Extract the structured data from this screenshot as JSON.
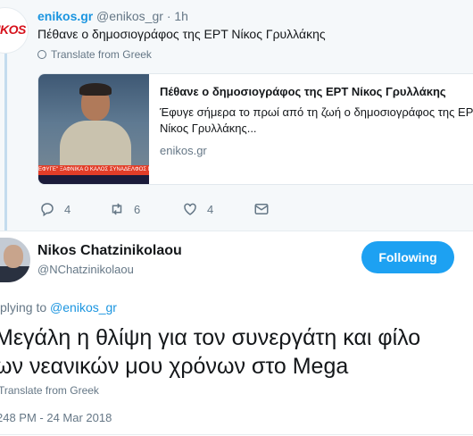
{
  "parent_tweet": {
    "author_name": "enikos.gr",
    "author_handle": "@enikos_gr",
    "time": "· 1h",
    "avatar_logo_text": "NIKOS",
    "text": "Πέθανε ο δημοσιογράφος της ΕΡΤ Νίκος Γρυλλάκης",
    "translate_label": "Translate from Greek",
    "card": {
      "title": "Πέθανε ο δημοσιογράφος της ΕΡΤ Νίκος Γρυλλάκης",
      "description": "Έφυγε σήμερα το πρωί από τη ζωή ο δημοσιογράφος της ΕΡΤ Νίκος Γρυλλάκης...",
      "domain": "enikos.gr",
      "image_banner": "ΕΦΥΓΕ\" ΞΑΦΝΙΚΑ Ο ΚΑΛΟΣ ΣΥΝΑΔΕΛΦΟΣ ΝΙΚΟΣ"
    },
    "actions": {
      "reply_count": "4",
      "retweet_count": "6",
      "like_count": "4"
    }
  },
  "main_tweet": {
    "author_name": "Nikos Chatzinikolaou",
    "author_handle": "@NChatzinikolaou",
    "follow_label": "Following",
    "replying_prefix": "plying to ",
    "replying_mention": "@enikos_gr",
    "text_line1": "Μεγάλη η θλίψη για τον συνεργάτη και φίλο",
    "text_line2": "ων νεανικών μου χρόνων στο Mega",
    "translate_label": "Translate from Greek",
    "timestamp": "248 PM - 24 Mar 2018"
  },
  "colors": {
    "accent": "#1da1f2",
    "link": "#1b95e0",
    "muted": "#657786",
    "parent_bg": "#f5f8fa"
  }
}
